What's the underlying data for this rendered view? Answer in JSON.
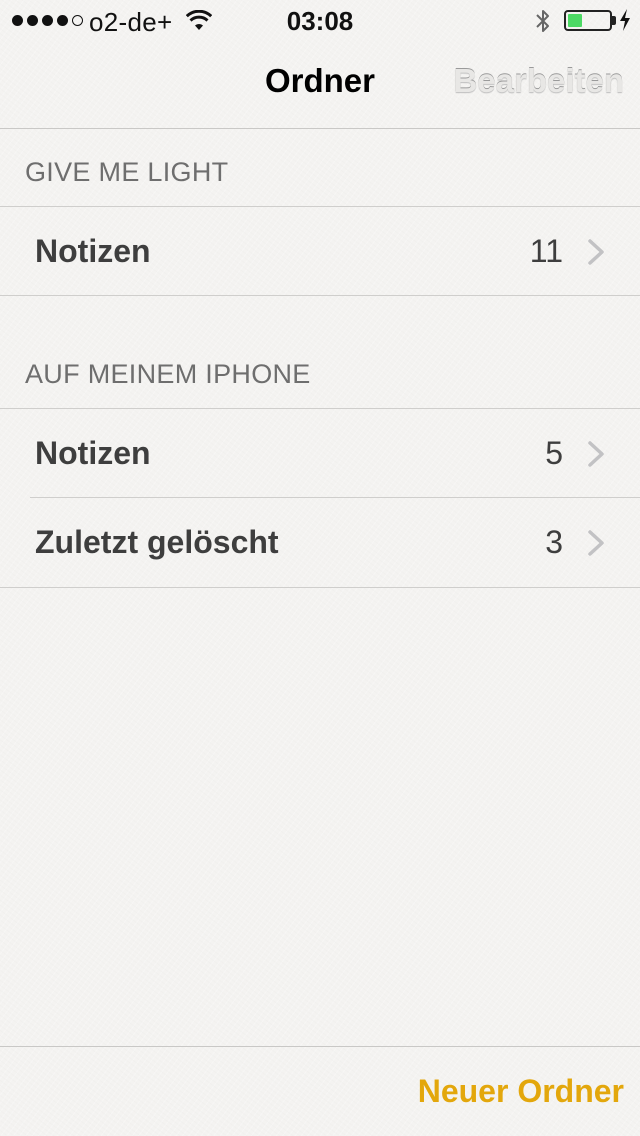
{
  "status_bar": {
    "signal_bars_filled": 4,
    "signal_bars_total": 5,
    "carrier": "o2-de+",
    "time": "03:08",
    "battery_level": 0.35,
    "battery_color": "#4cd964",
    "icons": [
      "wifi-icon",
      "bluetooth-icon",
      "battery-icon",
      "charging-bolt-icon"
    ]
  },
  "nav": {
    "title": "Ordner",
    "edit_label": "Bearbeiten"
  },
  "sections": [
    {
      "header": "GIVE ME LIGHT",
      "rows": [
        {
          "label": "Notizen",
          "count": "11"
        }
      ]
    },
    {
      "header": "AUF MEINEM IPHONE",
      "rows": [
        {
          "label": "Notizen",
          "count": "5"
        },
        {
          "label": "Zuletzt gelöscht",
          "count": "3"
        }
      ]
    }
  ],
  "toolbar": {
    "new_folder_label": "Neuer Ordner",
    "accent_color": "#e3a70c"
  }
}
